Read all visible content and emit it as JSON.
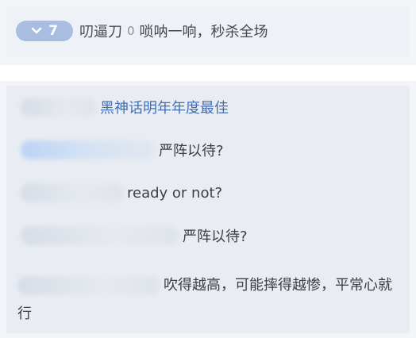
{
  "top_comment": {
    "vote_count": "7",
    "username": "叨逼刀",
    "score": "0",
    "text": "唢呐一响，秒杀全场"
  },
  "replies": [
    {
      "text": "黑神话明年年度最佳"
    },
    {
      "text": "严阵以待?"
    },
    {
      "text": "ready or not?"
    },
    {
      "text": "严阵以待?"
    },
    {
      "text": "吹得越高，可能摔得越惨，平常心就行"
    }
  ],
  "colors": {
    "badge": "#a9bde0",
    "link": "#3f6fb5",
    "panel": "#e9edf3"
  }
}
